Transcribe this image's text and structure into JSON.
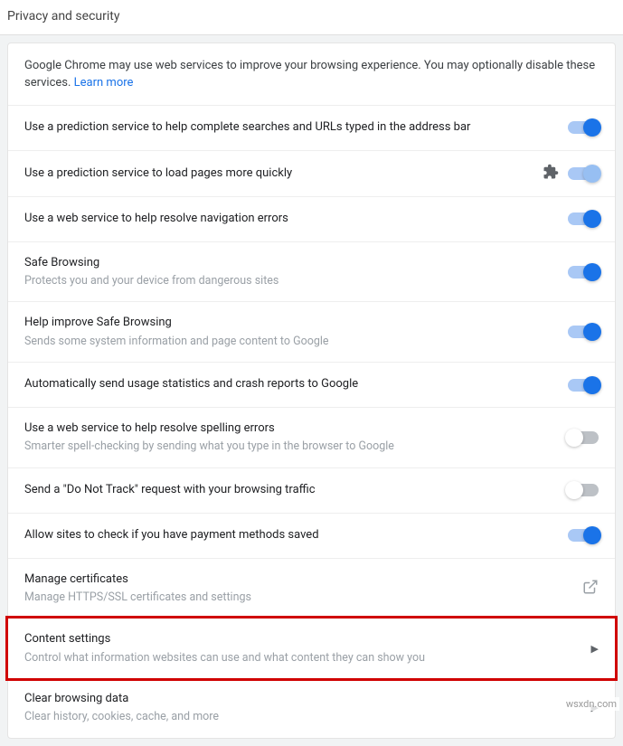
{
  "header": {
    "title": "Privacy and security"
  },
  "intro": {
    "text": "Google Chrome may use web services to improve your browsing experience. You may optionally disable these services. ",
    "link": "Learn more"
  },
  "rows": [
    {
      "title": "Use a prediction service to help complete searches and URLs typed in the address bar",
      "subtitle": "",
      "control": "toggle",
      "state": "on"
    },
    {
      "title": "Use a prediction service to load pages more quickly",
      "subtitle": "",
      "control": "toggle",
      "state": "half",
      "ext": true
    },
    {
      "title": "Use a web service to help resolve navigation errors",
      "subtitle": "",
      "control": "toggle",
      "state": "on"
    },
    {
      "title": "Safe Browsing",
      "subtitle": "Protects you and your device from dangerous sites",
      "control": "toggle",
      "state": "on"
    },
    {
      "title": "Help improve Safe Browsing",
      "subtitle": "Sends some system information and page content to Google",
      "control": "toggle",
      "state": "on"
    },
    {
      "title": "Automatically send usage statistics and crash reports to Google",
      "subtitle": "",
      "control": "toggle",
      "state": "on"
    },
    {
      "title": "Use a web service to help resolve spelling errors",
      "subtitle": "Smarter spell-checking by sending what you type in the browser to Google",
      "control": "toggle",
      "state": "off"
    },
    {
      "title": "Send a \"Do Not Track\" request with your browsing traffic",
      "subtitle": "",
      "control": "toggle",
      "state": "off"
    },
    {
      "title": "Allow sites to check if you have payment methods saved",
      "subtitle": "",
      "control": "toggle",
      "state": "on"
    },
    {
      "title": "Manage certificates",
      "subtitle": "Manage HTTPS/SSL certificates and settings",
      "control": "launch"
    },
    {
      "title": "Content settings",
      "subtitle": "Control what information websites can use and what content they can show you",
      "control": "chevron",
      "highlight": true
    },
    {
      "title": "Clear browsing data",
      "subtitle": "Clear history, cookies, cache, and more",
      "control": "chevron"
    }
  ],
  "watermark": "wsxdn.com"
}
